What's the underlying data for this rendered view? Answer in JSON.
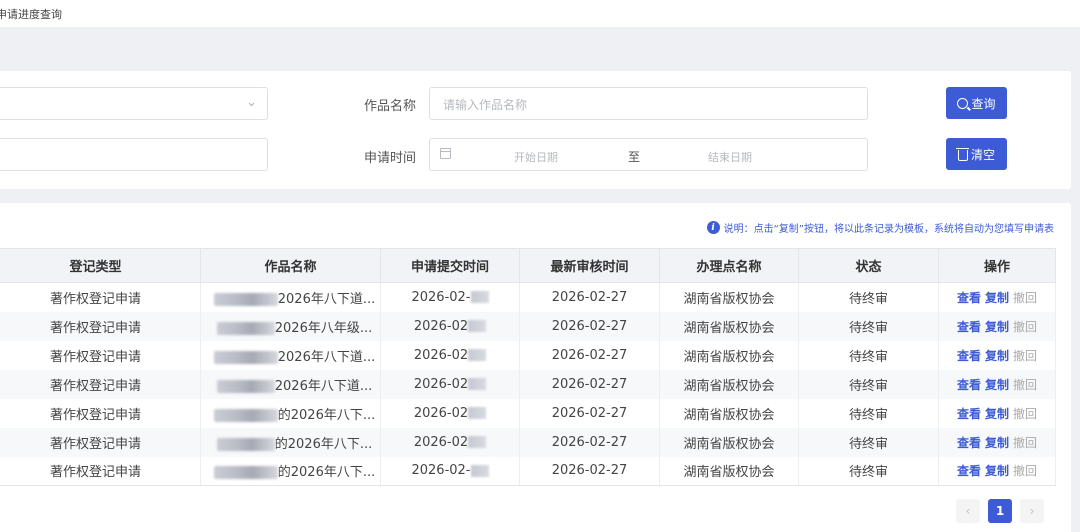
{
  "breadcrumb": "申请进度查询",
  "filters": {
    "name_label": "作品名称",
    "name_placeholder": "请输入作品名称",
    "time_label": "申请时间",
    "start_placeholder": "开始日期",
    "range_sep": "至",
    "end_placeholder": "结束日期",
    "search_button": "查询",
    "clear_button": "清空"
  },
  "note": "说明：点击“复制”按钮，将以此条记录为模板，系统将自动为您填写申请表",
  "table": {
    "headers": [
      "登记类型",
      "作品名称",
      "申请提交时间",
      "最新审核时间",
      "办理点名称",
      "状态",
      "操作"
    ],
    "rows": [
      {
        "type": "著作权登记申请",
        "name": "2026年八下道...",
        "submit": "2026-02-",
        "review": "2026-02-27",
        "office": "湖南省版权协会",
        "status": "待终审"
      },
      {
        "type": "著作权登记申请",
        "name": "2026年八年级...",
        "submit": "2026-02",
        "review": "2026-02-27",
        "office": "湖南省版权协会",
        "status": "待终审"
      },
      {
        "type": "著作权登记申请",
        "name": "2026年八下道...",
        "submit": "2026-02",
        "review": "2026-02-27",
        "office": "湖南省版权协会",
        "status": "待终审"
      },
      {
        "type": "著作权登记申请",
        "name": "2026年八下道...",
        "submit": "2026-02",
        "review": "2026-02-27",
        "office": "湖南省版权协会",
        "status": "待终审"
      },
      {
        "type": "著作权登记申请",
        "name": "的2026年八下...",
        "submit": "2026-02",
        "review": "2026-02-27",
        "office": "湖南省版权协会",
        "status": "待终审"
      },
      {
        "type": "著作权登记申请",
        "name": "的2026年八下...",
        "submit": "2026-02",
        "review": "2026-02-27",
        "office": "湖南省版权协会",
        "status": "待终审"
      },
      {
        "type": "著作权登记申请",
        "name": "的2026年八下...",
        "submit": "2026-02-",
        "review": "2026-02-27",
        "office": "湖南省版权协会",
        "status": "待终审"
      }
    ],
    "actions": {
      "view": "查看",
      "copy": "复制",
      "withdraw": "撤回"
    }
  },
  "pagination": {
    "prev": "‹",
    "current": "1",
    "next": "›"
  }
}
